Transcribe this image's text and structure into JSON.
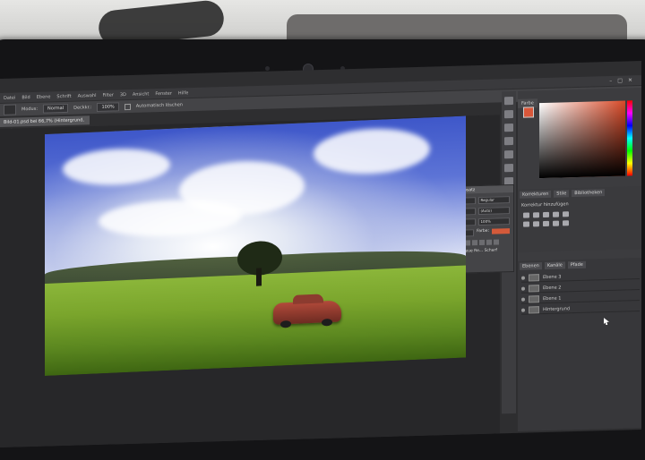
{
  "menubar": {
    "items": [
      "Datei",
      "Bild",
      "Ebene",
      "Schrift",
      "Auswahl",
      "Filter",
      "3D",
      "Ansicht",
      "Fenster",
      "Hilfe"
    ],
    "window_controls": [
      "–",
      "□",
      "✕"
    ]
  },
  "optionsbar": {
    "mode_label": "Modus:",
    "mode_value": "Normal",
    "opacity_label": "Deckkr.:",
    "opacity_value": "100%",
    "auto_label": "Automatisch löschen"
  },
  "document": {
    "tab_title": "Bild-01.psd bei 66,7% (Hintergrund, RGB/8)",
    "close": "×"
  },
  "character_panel": {
    "tabs": [
      "Zeichen",
      "Absatz"
    ],
    "font_family": "Arial",
    "font_style": "Regular",
    "size": "48 Pt",
    "leading": "(Auto)",
    "tracking": "Metrik",
    "scale": "100%",
    "baseline": "0 Pt",
    "color_label": "Farbe:",
    "language_label": "Deutsch: neue Re...",
    "aa_label": "Scharf"
  },
  "right_panel": {
    "color_tab": "Farbe",
    "adjust_tabs": [
      "Korrekturen",
      "Stile",
      "Bibliotheken"
    ],
    "adjust_title": "Korrektur hinzufügen",
    "layer_tabs": [
      "Ebenen",
      "Kanäle",
      "Pfade"
    ],
    "layers": [
      "Ebene 3",
      "Ebene 2",
      "Ebene 1",
      "Hintergrund"
    ]
  },
  "colors": {
    "foreground": "#d9573a",
    "accent_ui": "#3a3a3d"
  }
}
